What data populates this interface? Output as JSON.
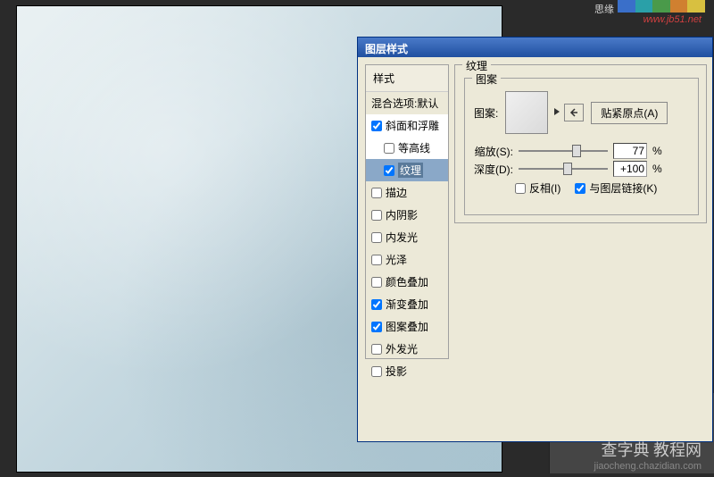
{
  "top_text": "思缘",
  "url_text": "www.jb51.net",
  "dialog": {
    "title": "图层样式",
    "styles_header": "样式",
    "blend_header": "混合选项:默认",
    "items": [
      {
        "label": "斜面和浮雕",
        "checked": true,
        "hl": true
      },
      {
        "label": "等高线",
        "checked": false,
        "indent": true,
        "hl": true
      },
      {
        "label": "纹理",
        "checked": true,
        "indent": true,
        "selected": true
      },
      {
        "label": "描边",
        "checked": false
      },
      {
        "label": "内阴影",
        "checked": false
      },
      {
        "label": "内发光",
        "checked": false
      },
      {
        "label": "光泽",
        "checked": false
      },
      {
        "label": "颜色叠加",
        "checked": false
      },
      {
        "label": "渐变叠加",
        "checked": true
      },
      {
        "label": "图案叠加",
        "checked": true
      },
      {
        "label": "外发光",
        "checked": false
      },
      {
        "label": "投影",
        "checked": false
      }
    ],
    "group_title": "纹理",
    "pattern_group": "图案",
    "pattern_label": "图案:",
    "snap_button": "贴紧原点(A)",
    "scale_label": "缩放(S):",
    "scale_value": "77",
    "scale_pct": "%",
    "scale_thumb_pos": "60",
    "depth_label": "深度(D):",
    "depth_value": "+100",
    "depth_pct": "%",
    "depth_thumb_pos": "50",
    "invert_label": "反相(I)",
    "invert_checked": false,
    "link_label": "与图层链接(K)",
    "link_checked": true
  },
  "bottom": {
    "line1": "查字典 教程网",
    "line2": "jiaocheng.chazidian.com"
  }
}
